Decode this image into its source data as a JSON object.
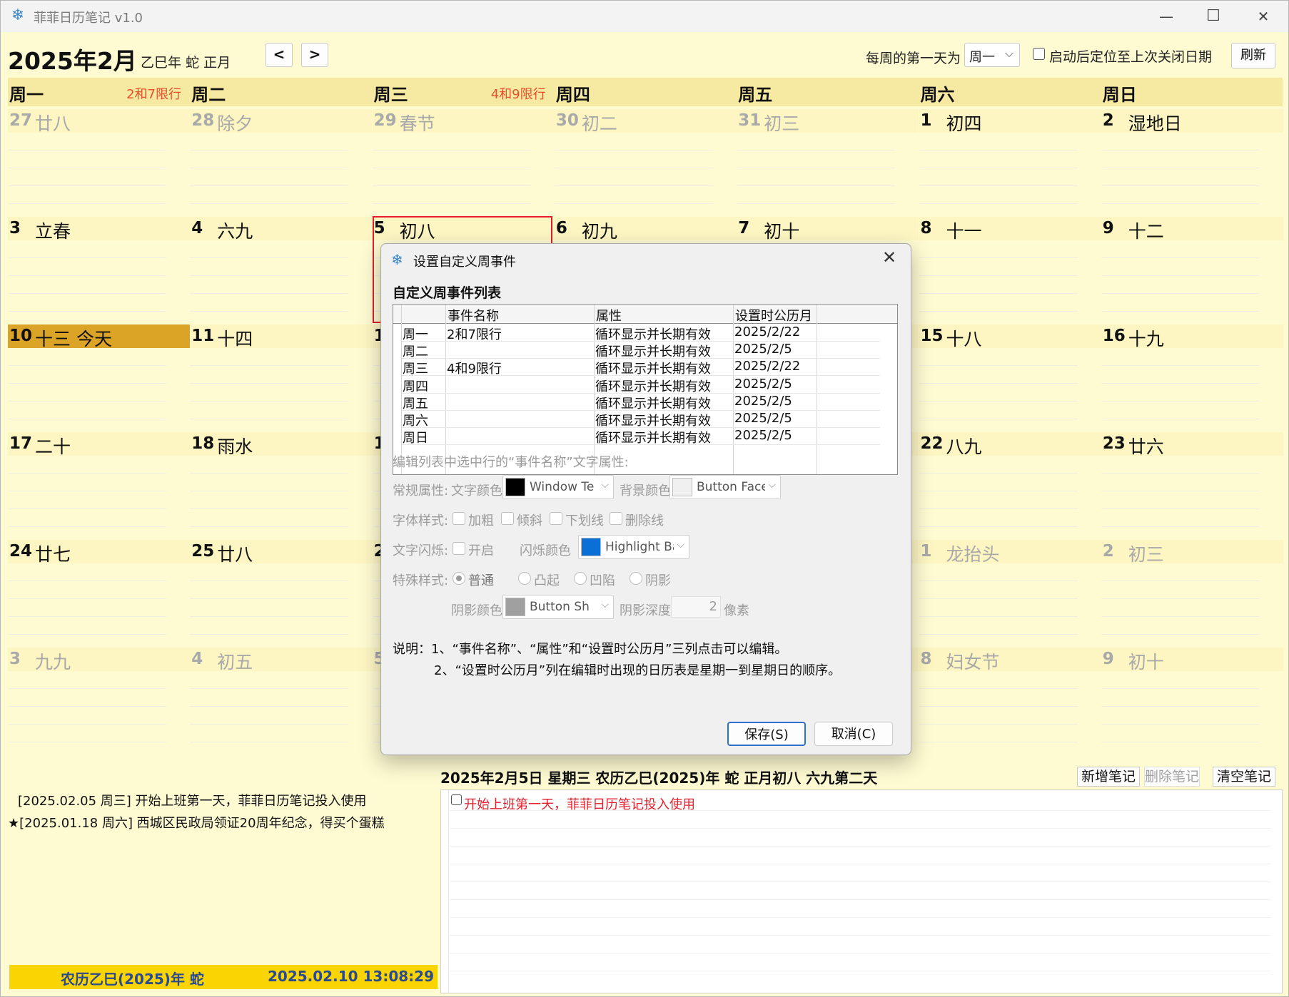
{
  "window": {
    "title": "菲菲日历笔记 v1.0",
    "min": "—",
    "max": "☐",
    "close": "✕"
  },
  "toolbar": {
    "month_title": "2025年2月",
    "lunar_year": "乙巳年 蛇 正月",
    "prev_label": "<",
    "next_label": ">",
    "first_day_label": "每周的第一天为",
    "first_day_value": "周一",
    "restore_label": "启动后定位至上次关闭日期",
    "refresh_label": "刷新"
  },
  "weekdays": [
    {
      "name": "周一",
      "event": "2和7限行"
    },
    {
      "name": "周二",
      "event": ""
    },
    {
      "name": "周三",
      "event": "4和9限行"
    },
    {
      "name": "周四",
      "event": ""
    },
    {
      "name": "周五",
      "event": ""
    },
    {
      "name": "周六",
      "event": ""
    },
    {
      "name": "周日",
      "event": ""
    }
  ],
  "weeks": [
    [
      {
        "d": "27",
        "l": "廿八",
        "dim": true
      },
      {
        "d": "28",
        "l": "除夕",
        "dim": true
      },
      {
        "d": "29",
        "l": "春节",
        "dim": true
      },
      {
        "d": "30",
        "l": "初二",
        "dim": true
      },
      {
        "d": "31",
        "l": "初三",
        "dim": true
      },
      {
        "d": "1",
        "l": "初四"
      },
      {
        "d": "2",
        "l": "湿地日"
      }
    ],
    [
      {
        "d": "3",
        "l": "立春"
      },
      {
        "d": "4",
        "l": "六九"
      },
      {
        "d": "5",
        "l": "初八",
        "sel": true
      },
      {
        "d": "6",
        "l": "初九"
      },
      {
        "d": "7",
        "l": "初十"
      },
      {
        "d": "8",
        "l": "十一"
      },
      {
        "d": "9",
        "l": "十二"
      }
    ],
    [
      {
        "d": "10",
        "l": "十三  今天",
        "today": true
      },
      {
        "d": "11",
        "l": "十四"
      },
      {
        "d": "1",
        "l": ""
      },
      {
        "d": "",
        "l": ""
      },
      {
        "d": "",
        "l": ""
      },
      {
        "d": "15",
        "l": "十八"
      },
      {
        "d": "16",
        "l": "十九"
      }
    ],
    [
      {
        "d": "17",
        "l": "二十"
      },
      {
        "d": "18",
        "l": "雨水"
      },
      {
        "d": "1",
        "l": ""
      },
      {
        "d": "",
        "l": ""
      },
      {
        "d": "",
        "l": ""
      },
      {
        "d": "22",
        "l": "八九"
      },
      {
        "d": "23",
        "l": "廿六"
      }
    ],
    [
      {
        "d": "24",
        "l": "廿七"
      },
      {
        "d": "25",
        "l": "廿八"
      },
      {
        "d": "2",
        "l": ""
      },
      {
        "d": "",
        "l": ""
      },
      {
        "d": "",
        "l": ""
      },
      {
        "d": "1",
        "l": "龙抬头",
        "dim": true
      },
      {
        "d": "2",
        "l": "初三",
        "dim": true
      }
    ],
    [
      {
        "d": "3",
        "l": "九九",
        "dim": true
      },
      {
        "d": "4",
        "l": "初五",
        "dim": true
      },
      {
        "d": "5",
        "l": "",
        "dim": true
      },
      {
        "d": "",
        "l": ""
      },
      {
        "d": "",
        "l": ""
      },
      {
        "d": "8",
        "l": "妇女节",
        "dim": true
      },
      {
        "d": "9",
        "l": "初十",
        "dim": true
      }
    ]
  ],
  "notes_list": [
    "[2025.02.05 周三] 开始上班第一天，菲菲日历笔记投入使用",
    "★[2025.01.18 周六] 西城区民政局领证20周年纪念，得买个蛋糕"
  ],
  "status": {
    "lunar": "农历乙巳(2025)年 蛇",
    "clock": "2025.02.10 13:08:29"
  },
  "note_panel": {
    "header": "2025年2月5日 星期三 农历乙巳(2025)年 蛇 正月初八 六九第二天",
    "add_label": "新增笔记",
    "delete_label": "删除笔记",
    "clear_label": "清空笔记",
    "entry": "开始上班第一天，菲菲日历笔记投入使用"
  },
  "dialog": {
    "title": "设置自定义周事件",
    "section_title": "自定义周事件列表",
    "columns": [
      "事件名称",
      "属性",
      "设置时公历月"
    ],
    "rows": [
      {
        "day": "周一",
        "name": "2和7限行",
        "attr": "循环显示并长期有效",
        "date": "2025/2/22"
      },
      {
        "day": "周二",
        "name": "",
        "attr": "循环显示并长期有效",
        "date": "2025/2/5"
      },
      {
        "day": "周三",
        "name": "4和9限行",
        "attr": "循环显示并长期有效",
        "date": "2025/2/22"
      },
      {
        "day": "周四",
        "name": "",
        "attr": "循环显示并长期有效",
        "date": "2025/2/5"
      },
      {
        "day": "周五",
        "name": "",
        "attr": "循环显示并长期有效",
        "date": "2025/2/5"
      },
      {
        "day": "周六",
        "name": "",
        "attr": "循环显示并长期有效",
        "date": "2025/2/5"
      },
      {
        "day": "周日",
        "name": "",
        "attr": "循环显示并长期有效",
        "date": "2025/2/5"
      }
    ],
    "edit_title": "编辑列表中选中行的“事件名称”文字属性:",
    "general_label": "常规属性:",
    "text_color_label": "文字颜色",
    "text_color_value": "Window Text",
    "bg_color_label": "背景颜色",
    "bg_color_value": "Button Face",
    "font_style_label": "字体样式:",
    "bold_label": "加粗",
    "italic_label": "倾斜",
    "underline_label": "下划线",
    "strike_label": "删除线",
    "blink_label": "文字闪烁:",
    "blink_on_label": "开启",
    "blink_color_label": "闪烁颜色",
    "blink_color_value": "Highlight Back",
    "special_label": "特殊样式:",
    "normal_label": "普通",
    "raised_label": "凸起",
    "sunken_label": "凹陷",
    "shadow_label": "阴影",
    "shadow_color_label": "阴影颜色",
    "shadow_color_value": "Button Shadow",
    "shadow_depth_label": "阴影深度",
    "shadow_depth_value": "2",
    "shadow_unit": "像素",
    "desc_1": "说明：1、“事件名称”、“属性”和“设置时公历月”三列点击可以编辑。",
    "desc_2": "2、“设置时公历月”列在编辑时出现的日历表是星期一到星期日的顺序。",
    "save_label": "保存(S)",
    "cancel_label": "取消(C)",
    "colors": {
      "text": "#000000",
      "bg": "#f0f0f0",
      "blink": "#0a6fd6",
      "shadow": "#a0a0a0"
    }
  }
}
